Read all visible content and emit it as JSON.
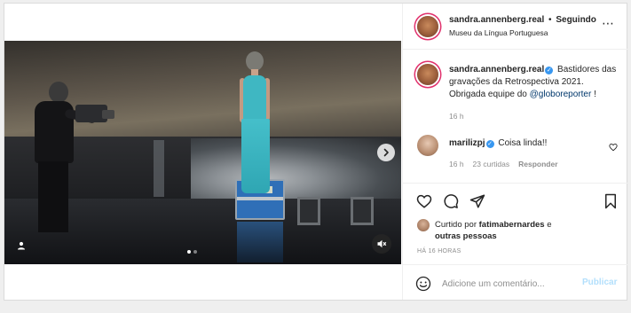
{
  "post": {
    "username": "sandra.annenberg.real",
    "follow_separator": "•",
    "follow_label": "Seguindo",
    "location": "Museu da Língua Portuguesa",
    "more_icon": "⋯",
    "caption": {
      "username": "sandra.annenberg.real",
      "text_1": "Bastidores das gravações da Retrospectiva 2021. Obrigada equipe do",
      "mention": "@globoreporter",
      "text_2": "!",
      "time": "16 h"
    },
    "comment": {
      "username": "marilizpj",
      "text": "Coisa linda!!",
      "time": "16 h",
      "likes": "23 curtidas",
      "reply_label": "Responder"
    },
    "likes": {
      "prefix": "Curtido por",
      "user": "fatimabernardes",
      "conjunction": "e",
      "others": "outras pessoas"
    },
    "timestamp": "HÁ 16 HORAS",
    "add_comment": {
      "placeholder": "Adicione um comentário...",
      "publish_label": "Publicar"
    }
  },
  "media": {
    "carousel_index": 1,
    "carousel_count": 2
  },
  "icons": {
    "verified": "✓",
    "more": "more-horizontal-icon",
    "like": "heart-icon",
    "comment": "comment-bubble-icon",
    "share": "paper-plane-icon",
    "save": "bookmark-icon",
    "emoji": "smiley-icon",
    "mute": "speaker-muted-icon",
    "user_tag": "person-icon",
    "next": "chevron-right-icon"
  },
  "colors": {
    "verified": "#3897f0",
    "mention": "#00376b",
    "publish_disabled": "#b2dffc",
    "dress": "#3fb7c2",
    "case": "#2f6fb7"
  }
}
